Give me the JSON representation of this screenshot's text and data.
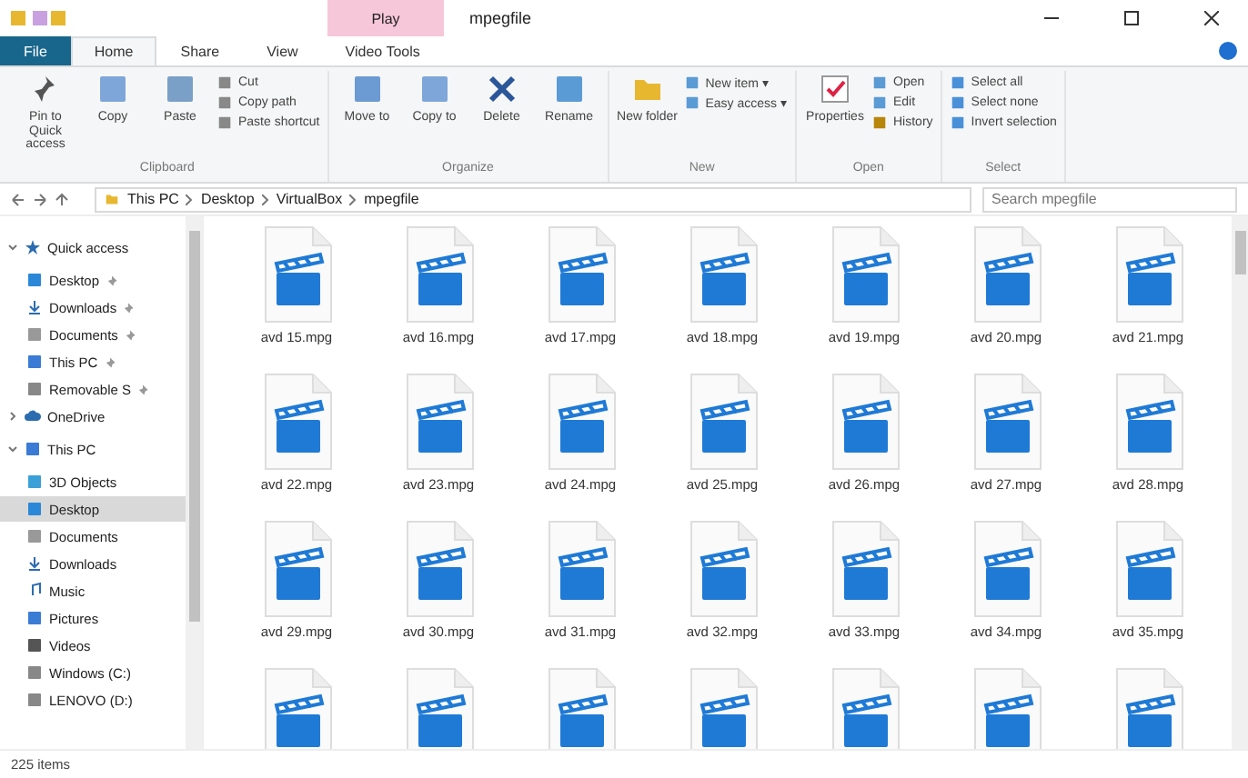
{
  "window": {
    "title": "mpegfile",
    "context_tab": "Play"
  },
  "tabs": [
    {
      "label": "File",
      "kind": "file",
      "selected": false
    },
    {
      "label": "Home",
      "kind": "tab",
      "selected": true
    },
    {
      "label": "Share",
      "kind": "tab",
      "selected": false
    },
    {
      "label": "View",
      "kind": "tab",
      "selected": false
    },
    {
      "label": "Video Tools",
      "kind": "tab",
      "selected": false
    }
  ],
  "ribbon": [
    {
      "name": "Clipboard",
      "items": [
        {
          "kind": "large",
          "label": "Pin to Quick access"
        },
        {
          "kind": "large",
          "label": "Copy"
        },
        {
          "kind": "large",
          "label": "Paste"
        },
        {
          "kind": "stack",
          "items": [
            {
              "label": "Cut"
            },
            {
              "label": "Copy path"
            },
            {
              "label": "Paste shortcut"
            }
          ]
        }
      ]
    },
    {
      "name": "Organize",
      "items": [
        {
          "kind": "large",
          "label": "Move to"
        },
        {
          "kind": "large",
          "label": "Copy to"
        },
        {
          "kind": "large",
          "label": "Delete"
        },
        {
          "kind": "large",
          "label": "Rename"
        }
      ]
    },
    {
      "name": "New",
      "items": [
        {
          "kind": "large",
          "label": "New folder"
        },
        {
          "kind": "stack",
          "items": [
            {
              "label": "New item ▾"
            },
            {
              "label": "Easy access ▾"
            }
          ]
        }
      ]
    },
    {
      "name": "Open",
      "items": [
        {
          "kind": "large",
          "label": "Properties"
        },
        {
          "kind": "stack",
          "items": [
            {
              "label": "Open"
            },
            {
              "label": "Edit"
            },
            {
              "label": "History"
            }
          ]
        }
      ]
    },
    {
      "name": "Select",
      "items": [
        {
          "kind": "stack",
          "items": [
            {
              "label": "Select all"
            },
            {
              "label": "Select none"
            },
            {
              "label": "Invert selection"
            }
          ]
        }
      ]
    }
  ],
  "address": {
    "path": [
      "This PC",
      "Desktop",
      "VirtualBox",
      "mpegfile"
    ],
    "search_placeholder": "Search mpegfile"
  },
  "sidebar": [
    {
      "label": "Quick access",
      "expanded": true,
      "selected": false,
      "children": [
        {
          "label": "Desktop",
          "pinned": true,
          "selected": false
        },
        {
          "label": "Downloads",
          "pinned": true,
          "selected": false
        },
        {
          "label": "Documents",
          "pinned": true,
          "selected": false
        },
        {
          "label": "This PC",
          "pinned": true,
          "selected": false
        },
        {
          "label": "Removable S",
          "pinned": true,
          "selected": false
        }
      ]
    },
    {
      "label": "OneDrive",
      "expanded": false,
      "selected": false
    },
    {
      "label": "This PC",
      "expanded": true,
      "selected": false,
      "children": [
        {
          "label": "3D Objects",
          "selected": false
        },
        {
          "label": "Desktop",
          "selected": true
        },
        {
          "label": "Documents",
          "selected": false
        },
        {
          "label": "Downloads",
          "selected": false
        },
        {
          "label": "Music",
          "selected": false
        },
        {
          "label": "Pictures",
          "selected": false
        },
        {
          "label": "Videos",
          "selected": false
        },
        {
          "label": "Windows (C:)",
          "selected": false
        },
        {
          "label": "LENOVO (D:)",
          "selected": false
        }
      ]
    }
  ],
  "files": [
    {
      "kind": "file",
      "name": "avd 15.mpg"
    },
    {
      "kind": "file",
      "name": "avd 16.mpg"
    },
    {
      "kind": "file",
      "name": "avd 17.mpg"
    },
    {
      "kind": "file",
      "name": "avd 18.mpg"
    },
    {
      "kind": "file",
      "name": "avd 19.mpg"
    },
    {
      "kind": "file",
      "name": "avd 20.mpg"
    },
    {
      "kind": "file",
      "name": "avd 21.mpg"
    },
    {
      "kind": "file",
      "name": "avd 22.mpg"
    },
    {
      "kind": "file",
      "name": "avd 23.mpg"
    },
    {
      "kind": "file",
      "name": "avd 24.mpg"
    },
    {
      "kind": "file",
      "name": "avd 25.mpg"
    },
    {
      "kind": "file",
      "name": "avd 26.mpg"
    },
    {
      "kind": "file",
      "name": "avd 27.mpg"
    },
    {
      "kind": "file",
      "name": "avd 28.mpg"
    },
    {
      "kind": "file",
      "name": "avd 29.mpg"
    },
    {
      "kind": "file",
      "name": "avd 30.mpg"
    },
    {
      "kind": "file",
      "name": "avd 31.mpg"
    },
    {
      "kind": "file",
      "name": "avd 32.mpg"
    },
    {
      "kind": "file",
      "name": "avd 33.mpg"
    },
    {
      "kind": "file",
      "name": "avd 34.mpg"
    },
    {
      "kind": "file",
      "name": "avd 35.mpg"
    },
    {
      "kind": "cut"
    },
    {
      "kind": "cut"
    },
    {
      "kind": "cut"
    },
    {
      "kind": "cut"
    },
    {
      "kind": "cut"
    },
    {
      "kind": "cut"
    },
    {
      "kind": "cut"
    }
  ],
  "status_bar": {
    "count": "225 items"
  }
}
